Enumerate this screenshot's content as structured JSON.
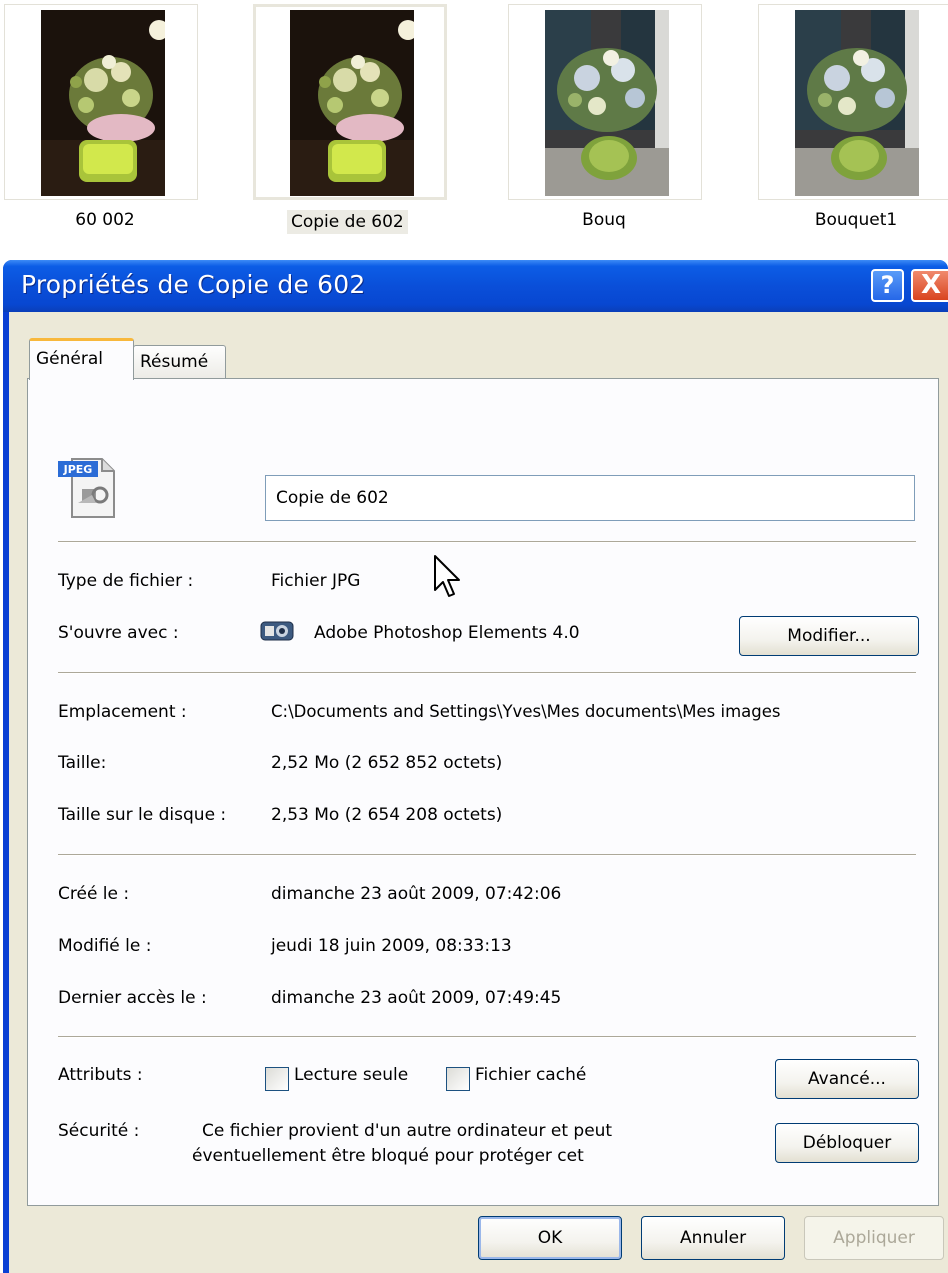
{
  "thumbnails": [
    {
      "label": "60 002",
      "selected": false
    },
    {
      "label": "Copie de 602",
      "selected": true
    },
    {
      "label": "Bouq",
      "selected": false
    },
    {
      "label": "Bouquet1",
      "selected": false
    }
  ],
  "dialog": {
    "title": "Propriétés de Copie de 602",
    "help_label": "?",
    "close_label": "X",
    "tabs": {
      "general": "Général",
      "resume": "Résumé"
    },
    "icon_badge": "JPEG",
    "file_name": "Copie de 602",
    "type_label": "Type de fichier :",
    "type_value": "Fichier JPG",
    "opens_with_label": "S'ouvre avec :",
    "opens_with_value": "Adobe Photoshop Elements 4.0",
    "modify_button": "Modifier...",
    "location_label": "Emplacement :",
    "location_value": "C:\\Documents and Settings\\Yves\\Mes documents\\Mes images",
    "size_label": "Taille:",
    "size_value": "2,52 Mo (2 652 852 octets)",
    "disk_size_label": "Taille sur le disque :",
    "disk_size_value": "2,53 Mo (2 654 208 octets)",
    "created_label": "Créé le :",
    "created_value": "dimanche 23 août 2009, 07:42:06",
    "modified_label": "Modifié le :",
    "modified_value": "jeudi 18 juin 2009, 08:33:13",
    "accessed_label": "Dernier accès le :",
    "accessed_value": "dimanche 23 août 2009, 07:49:45",
    "attributes_label": "Attributs :",
    "readonly_label": "Lecture seule",
    "hidden_label": "Fichier caché",
    "advanced_button": "Avancé...",
    "security_label": "Sécurité :",
    "security_line1": "Ce fichier provient d'un autre ordinateur et peut",
    "security_line2": "éventuellement être bloqué pour protéger cet",
    "unblock_button": "Débloquer",
    "ok_button": "OK",
    "cancel_button": "Annuler",
    "apply_button": "Appliquer"
  },
  "colors": {
    "titlebar": "#0a4fd9",
    "dialog_bg": "#ece9d8",
    "tab_accent": "#f8b83c",
    "close_red": "#d9441f"
  }
}
